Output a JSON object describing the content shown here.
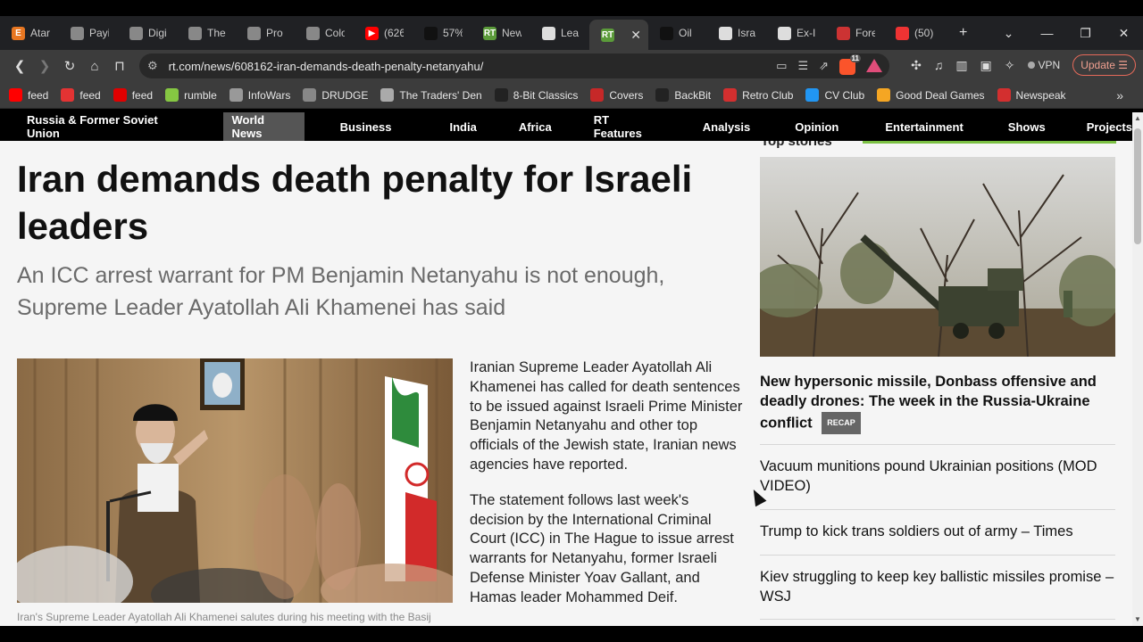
{
  "browser": {
    "tabs": [
      {
        "label": "Atar",
        "fav_color": "#e87722",
        "glyph": "E"
      },
      {
        "label": "Payi",
        "fav_color": "#888888",
        "glyph": ""
      },
      {
        "label": "Digi",
        "fav_color": "#888888",
        "glyph": ""
      },
      {
        "label": "The",
        "fav_color": "#888888",
        "glyph": ""
      },
      {
        "label": "Pro",
        "fav_color": "#888888",
        "glyph": ""
      },
      {
        "label": "Colo",
        "fav_color": "#888888",
        "glyph": ""
      },
      {
        "label": "(626",
        "fav_color": "#ff0000",
        "glyph": "▶"
      },
      {
        "label": "57%",
        "fav_color": "#111111",
        "glyph": ""
      },
      {
        "label": "New",
        "fav_color": "#5b9b3a",
        "glyph": "RT"
      },
      {
        "label": "Lea",
        "fav_color": "#dddddd",
        "glyph": ""
      },
      {
        "label": "",
        "fav_color": "#5b9b3a",
        "glyph": "RT"
      },
      {
        "label": "Oil",
        "fav_color": "#111111",
        "glyph": ""
      },
      {
        "label": "Isra",
        "fav_color": "#dddddd",
        "glyph": ""
      },
      {
        "label": "Ex-I",
        "fav_color": "#dddddd",
        "glyph": ""
      },
      {
        "label": "Fore",
        "fav_color": "#c33",
        "glyph": ""
      },
      {
        "label": "(50)",
        "fav_color": "#e33",
        "glyph": ""
      }
    ],
    "url": "rt.com/news/608162-iran-demands-death-penalty-netanyahu/",
    "vpn_label": "VPN",
    "update_label": "Update",
    "bookmarks": [
      {
        "label": "feed",
        "color": "#ff0000"
      },
      {
        "label": "feed",
        "color": "#e33333"
      },
      {
        "label": "feed",
        "color": "#e00000"
      },
      {
        "label": "rumble",
        "color": "#85c742"
      },
      {
        "label": "InfoWars",
        "color": "#999999"
      },
      {
        "label": "DRUDGE",
        "color": "#888888"
      },
      {
        "label": "The Traders' Den",
        "color": "#aaaaaa"
      },
      {
        "label": "8-Bit Classics",
        "color": "#222222"
      },
      {
        "label": "Covers",
        "color": "#c62828"
      },
      {
        "label": "BackBit",
        "color": "#222222"
      },
      {
        "label": "Retro Club",
        "color": "#d32f2f"
      },
      {
        "label": "CV Club",
        "color": "#2196f3"
      },
      {
        "label": "Good Deal Games",
        "color": "#f5a623"
      },
      {
        "label": "Newspeak",
        "color": "#d32f2f"
      }
    ]
  },
  "rt_nav": [
    {
      "label": "Russia & Former Soviet Union",
      "active": false
    },
    {
      "label": "World News",
      "active": true
    },
    {
      "label": "Business",
      "active": false
    },
    {
      "label": "India",
      "active": false
    },
    {
      "label": "Africa",
      "active": false
    },
    {
      "label": "RT Features",
      "active": false
    },
    {
      "label": "Analysis",
      "active": false
    },
    {
      "label": "Opinion",
      "active": false
    },
    {
      "label": "Entertainment",
      "active": false
    },
    {
      "label": "Shows",
      "active": false
    },
    {
      "label": "Projects",
      "active": false
    }
  ],
  "article": {
    "headline": "Iran demands death penalty for Israeli leaders",
    "subheadline": "An ICC arrest warrant for PM Benjamin Netanyahu is not enough, Supreme Leader Ayatollah Ali Khamenei has said",
    "caption": "Iran's Supreme Leader Ayatollah Ali Khamenei salutes during his meeting with the Basij",
    "paragraphs": [
      "Iranian Supreme Leader Ayatollah Ali Khamenei has called for death sentences to be issued against Israeli Prime Minister Benjamin Netanyahu and other top officials of the Jewish state, Iranian news agencies have reported.",
      "The statement follows last week's decision by the International Criminal Court (ICC) in The Hague to issue arrest warrants for Netanyahu, former Israeli Defense Minister Yoav Gallant, and Hamas leader Mohammed Deif."
    ]
  },
  "sidebar": {
    "section_title": "Top stories",
    "lead_story": "New hypersonic missile, Donbass offensive and deadly drones: The week in the Russia-Ukraine conflict",
    "lead_badge": "RECAP",
    "stories": [
      "Vacuum munitions pound Ukrainian positions (MOD VIDEO)",
      "Trump to kick trans soldiers out of army – Times",
      "Kiev struggling to keep key ballistic missiles promise – WSJ"
    ]
  }
}
